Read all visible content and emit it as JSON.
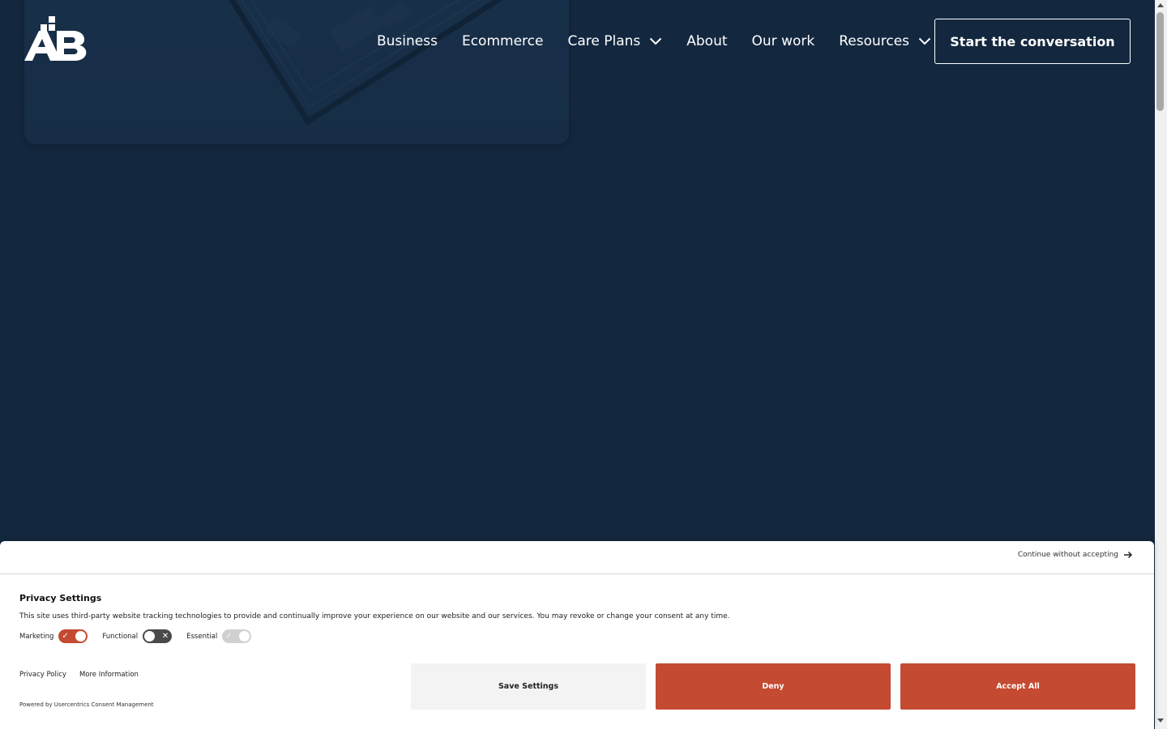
{
  "header": {
    "logo_alt": "AB",
    "nav": [
      {
        "label": "Business",
        "has_dropdown": false
      },
      {
        "label": "Ecommerce",
        "has_dropdown": false
      },
      {
        "label": "Care Plans",
        "has_dropdown": true
      },
      {
        "label": "About",
        "has_dropdown": false
      },
      {
        "label": "Our work",
        "has_dropdown": false
      },
      {
        "label": "Resources",
        "has_dropdown": true
      }
    ],
    "cta_label": "Start the conversation"
  },
  "consent": {
    "continue_label": "Continue without accepting",
    "title": "Privacy Settings",
    "description": "This site uses third-party website tracking technologies to provide and continually improve your experience on our website and our services. You may revoke or change your consent at any time.",
    "toggles": [
      {
        "label": "Marketing",
        "state": "on"
      },
      {
        "label": "Functional",
        "state": "off"
      },
      {
        "label": "Essential",
        "state": "disabled-on"
      }
    ],
    "links": [
      "Privacy Policy",
      "More Information"
    ],
    "powered_by": "Powered by Usercentrics Consent Management",
    "buttons": {
      "save": "Save Settings",
      "deny": "Deny",
      "accept": "Accept All"
    }
  },
  "colors": {
    "background": "#13283f",
    "accent": "#c44a32",
    "banner": "#ffffff"
  },
  "icons": {
    "dropdown": "chevron-down-icon",
    "continue": "arrow-right-icon",
    "toggle_on": "check-icon",
    "toggle_off": "x-icon"
  }
}
